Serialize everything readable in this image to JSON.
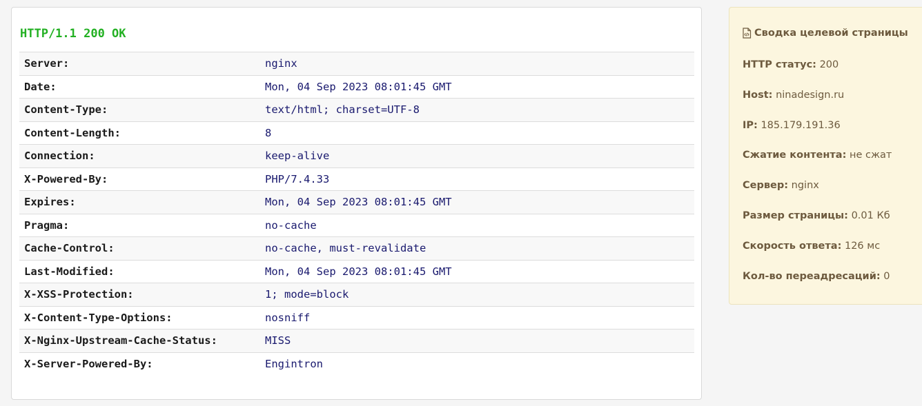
{
  "response": {
    "status_line": "HTTP/1.1 200 OK",
    "headers": [
      {
        "name": "Server:",
        "value": "nginx"
      },
      {
        "name": "Date:",
        "value": "Mon, 04 Sep 2023 08:01:45 GMT"
      },
      {
        "name": "Content-Type:",
        "value": "text/html; charset=UTF-8"
      },
      {
        "name": "Content-Length:",
        "value": "8"
      },
      {
        "name": "Connection:",
        "value": "keep-alive"
      },
      {
        "name": "X-Powered-By:",
        "value": "PHP/7.4.33"
      },
      {
        "name": "Expires:",
        "value": "Mon, 04 Sep 2023 08:01:45 GMT"
      },
      {
        "name": "Pragma:",
        "value": "no-cache"
      },
      {
        "name": "Cache-Control:",
        "value": "no-cache, must-revalidate"
      },
      {
        "name": "Last-Modified:",
        "value": "Mon, 04 Sep 2023 08:01:45 GMT"
      },
      {
        "name": "X-XSS-Protection:",
        "value": "1; mode=block"
      },
      {
        "name": "X-Content-Type-Options:",
        "value": "nosniff"
      },
      {
        "name": "X-Nginx-Upstream-Cache-Status:",
        "value": "MISS"
      },
      {
        "name": "X-Server-Powered-By:",
        "value": "Engintron"
      }
    ]
  },
  "summary": {
    "title": "Сводка целевой страницы",
    "icon": "document-code-icon",
    "rows": [
      {
        "label": "HTTP статус:",
        "value": "200"
      },
      {
        "label": "Host:",
        "value": "ninadesign.ru"
      },
      {
        "label": "IP:",
        "value": "185.179.191.36"
      },
      {
        "label": "Сжатие контента:",
        "value": "не сжат"
      },
      {
        "label": "Сервер:",
        "value": "nginx"
      },
      {
        "label": "Размер страницы:",
        "value": "0.01 Кб"
      },
      {
        "label": "Скорость ответа:",
        "value": "126 мс"
      },
      {
        "label": "Кол-во переадресаций:",
        "value": "0"
      }
    ]
  },
  "colors": {
    "status_green": "#22b022",
    "header_value": "#19196e",
    "summary_bg": "#fcf6df",
    "summary_text": "#6d5a3e"
  }
}
